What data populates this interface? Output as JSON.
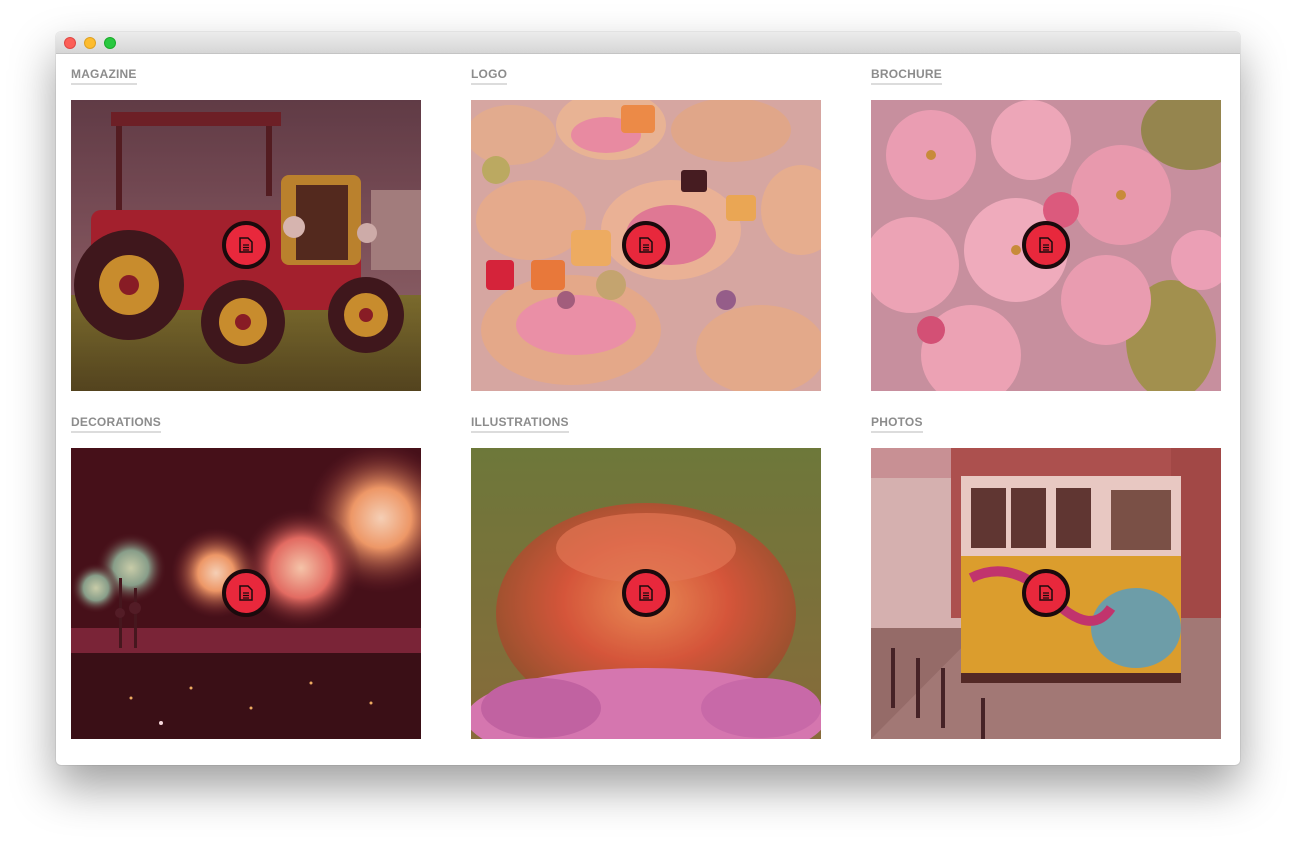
{
  "window": {
    "traffic_lights": [
      "close",
      "minimize",
      "zoom"
    ]
  },
  "gallery": {
    "accent_color": "#e8283c",
    "items": [
      {
        "label": "MAGAZINE",
        "icon": "document-icon"
      },
      {
        "label": "LOGO",
        "icon": "document-icon"
      },
      {
        "label": "BROCHURE",
        "icon": "document-icon"
      },
      {
        "label": "DECORATIONS",
        "icon": "document-icon"
      },
      {
        "label": "ILLUSTRATIONS",
        "icon": "document-icon"
      },
      {
        "label": "PHOTOS",
        "icon": "document-icon"
      }
    ]
  }
}
